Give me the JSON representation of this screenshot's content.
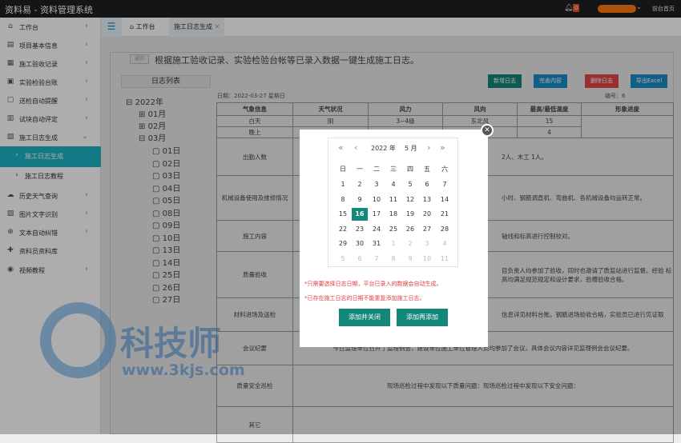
{
  "app": {
    "title": "资料易 - 资料管理系统",
    "badge": "0",
    "home": "前台首页"
  },
  "icons": {
    "bell": "bell-icon",
    "menu": "menu-icon",
    "home": "home-icon",
    "close": "close-icon"
  },
  "sidebar": {
    "items": [
      {
        "icon": "⌂",
        "label": "工作台",
        "chev": "‹"
      },
      {
        "icon": "▤",
        "label": "项目基本信息",
        "chev": "‹"
      },
      {
        "icon": "▦",
        "label": "施工验收记录",
        "chev": "‹"
      },
      {
        "icon": "▣",
        "label": "实验检验台账",
        "chev": "‹"
      },
      {
        "icon": "▢",
        "label": "送检自动提醒",
        "chev": "‹"
      },
      {
        "icon": "▥",
        "label": "试块自动评定",
        "chev": "‹"
      },
      {
        "icon": "▧",
        "label": "施工日志生成",
        "chev": "⌄"
      },
      {
        "icon": "›",
        "label": "施工日志生成",
        "chev": ""
      },
      {
        "icon": "›",
        "label": "施工日志教程",
        "chev": ""
      },
      {
        "icon": "☁",
        "label": "历史天气查询",
        "chev": "‹"
      },
      {
        "icon": "▨",
        "label": "图片文字识别",
        "chev": "‹"
      },
      {
        "icon": "⊕",
        "label": "文本自动纠错",
        "chev": "‹"
      },
      {
        "icon": "✚",
        "label": "资料员资料库",
        "chev": ""
      },
      {
        "icon": "◉",
        "label": "视频教程",
        "chev": "‹"
      }
    ]
  },
  "tabs": [
    {
      "label": "工作台"
    },
    {
      "label": "施工日志生成"
    }
  ],
  "page": {
    "back": "返回",
    "headline": "根据施工验收记录、实验检验台帐等已录入数据一键生成施工日志。",
    "loglist": "日志列表",
    "date": "日期：2022-03-27 星期日",
    "serial": "编号：6"
  },
  "actions": [
    "新增日志",
    "完善内容",
    "删除日志",
    "导出Excel"
  ],
  "tree": {
    "year": "2022年",
    "months": [
      "01月",
      "02月",
      "03月"
    ],
    "days": [
      "01日",
      "02日",
      "03日",
      "04日",
      "05日",
      "08日",
      "09日",
      "10日",
      "13日",
      "14日",
      "25日",
      "26日",
      "27日"
    ]
  },
  "table": {
    "headers": [
      "气象信息",
      "天气状况",
      "风力",
      "风向",
      "最高/最低温度",
      "形象进度"
    ],
    "rows": [
      [
        "白天",
        "阴",
        "3~4级",
        "东北风",
        "15"
      ],
      [
        "晚上",
        "",
        "",
        "",
        "4"
      ]
    ],
    "sections": [
      {
        "label": "出勤人数",
        "text": "2人、木工 1人。"
      },
      {
        "label": "机械设备使用及维修情况",
        "text": "小时、钢筋调直机、弯曲机、各机械设备均运转正常。"
      },
      {
        "label": "施工内容",
        "text": "轴线和标高进行控制校对。"
      },
      {
        "label": "质量验收",
        "text": "目负责人均参加了验收，同时也邀请了质监站进行监督。经验 标高均满足规范规定和设计要求，验槽验收合格。"
      },
      {
        "label": "材料进场及送检",
        "text": "信息详见材料台账。钢筋进场验收合格，实验员已进行见证取"
      },
      {
        "label": "会议纪要",
        "text": "今日监理单位召开了监理例会，建设单位施工单位管理人员均参加了会议，具体会议内容详见监理例会会议纪要。"
      },
      {
        "label": "质量安全巡检",
        "text": "现场巡检过程中发现以下质量问题：现场巡检过程中发现以下安全问题："
      },
      {
        "label": "其它",
        "text": ""
      }
    ]
  },
  "calendar": {
    "year": "2022 年",
    "month": "5 月",
    "prev_year": "«",
    "prev": "‹",
    "next": "›",
    "next_year": "»",
    "weekdays": [
      "日",
      "一",
      "二",
      "三",
      "四",
      "五",
      "六"
    ],
    "weeks": [
      [
        "1",
        "2",
        "3",
        "4",
        "5",
        "6",
        "7"
      ],
      [
        "8",
        "9",
        "10",
        "11",
        "12",
        "13",
        "14"
      ],
      [
        "15",
        "16",
        "17",
        "18",
        "19",
        "20",
        "21"
      ],
      [
        "22",
        "23",
        "24",
        "25",
        "26",
        "27",
        "28"
      ],
      [
        "29",
        "30",
        "31",
        "1",
        "2",
        "3",
        "4"
      ],
      [
        "5",
        "6",
        "7",
        "8",
        "9",
        "10",
        "11"
      ]
    ],
    "selected": "16"
  },
  "modal": {
    "note1": "*只需要选择日志日期，平台已录入的数据会自动生成。",
    "note2": "*已存在施工日志的日期不能重复添加施工日志。",
    "btn_close": "添加并关闭",
    "btn_again": "添加再添加"
  },
  "watermark": {
    "name": "科技师",
    "url": "www.3kjs.com"
  }
}
